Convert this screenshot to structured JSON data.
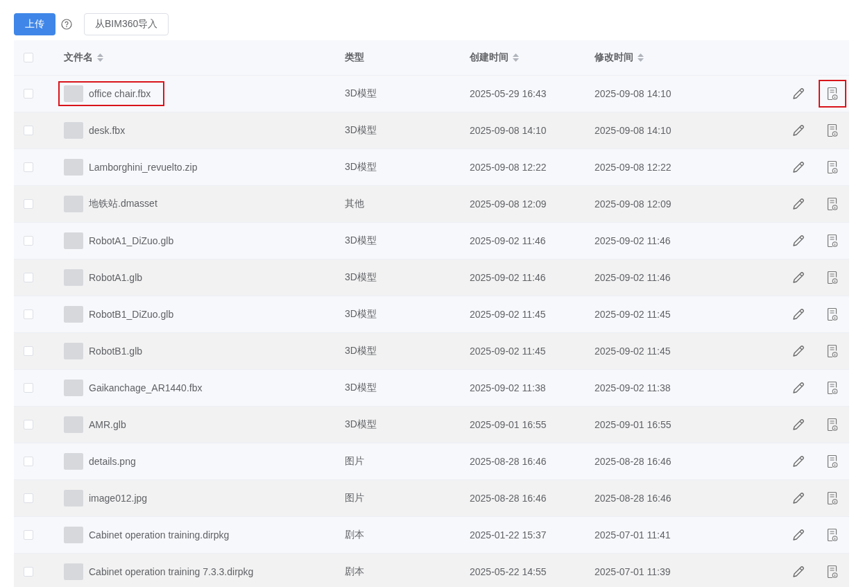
{
  "toolbar": {
    "upload_button": "上传",
    "import_button": "从BIM360导入"
  },
  "select_all_checked": false,
  "table": {
    "columns": [
      {
        "label": "文件名",
        "sortable": true
      },
      {
        "label": "类型",
        "sortable": false
      },
      {
        "label": "创建时间",
        "sortable": true
      },
      {
        "label": "修改时间",
        "sortable": true
      }
    ],
    "rows": [
      {
        "name": "office chair.fbx",
        "type": "3D模型",
        "created": "2025-05-29 16:43",
        "modified": "2025-09-08 14:10",
        "checked": false,
        "name_highlighted": true,
        "info_highlighted": true
      },
      {
        "name": "desk.fbx",
        "type": "3D模型",
        "created": "2025-09-08 14:10",
        "modified": "2025-09-08 14:10",
        "checked": false,
        "name_highlighted": false,
        "info_highlighted": false
      },
      {
        "name": "Lamborghini_revuelto.zip",
        "type": "3D模型",
        "created": "2025-09-08 12:22",
        "modified": "2025-09-08 12:22",
        "checked": false,
        "name_highlighted": false,
        "info_highlighted": false
      },
      {
        "name": "地铁站.dmasset",
        "type": "其他",
        "created": "2025-09-08 12:09",
        "modified": "2025-09-08 12:09",
        "checked": false,
        "name_highlighted": false,
        "info_highlighted": false
      },
      {
        "name": "RobotA1_DiZuo.glb",
        "type": "3D模型",
        "created": "2025-09-02 11:46",
        "modified": "2025-09-02 11:46",
        "checked": false,
        "name_highlighted": false,
        "info_highlighted": false
      },
      {
        "name": "RobotA1.glb",
        "type": "3D模型",
        "created": "2025-09-02 11:46",
        "modified": "2025-09-02 11:46",
        "checked": false,
        "name_highlighted": false,
        "info_highlighted": false
      },
      {
        "name": "RobotB1_DiZuo.glb",
        "type": "3D模型",
        "created": "2025-09-02 11:45",
        "modified": "2025-09-02 11:45",
        "checked": false,
        "name_highlighted": false,
        "info_highlighted": false
      },
      {
        "name": "RobotB1.glb",
        "type": "3D模型",
        "created": "2025-09-02 11:45",
        "modified": "2025-09-02 11:45",
        "checked": false,
        "name_highlighted": false,
        "info_highlighted": false
      },
      {
        "name": "Gaikanchage_AR1440.fbx",
        "type": "3D模型",
        "created": "2025-09-02 11:38",
        "modified": "2025-09-02 11:38",
        "checked": false,
        "name_highlighted": false,
        "info_highlighted": false
      },
      {
        "name": "AMR.glb",
        "type": "3D模型",
        "created": "2025-09-01 16:55",
        "modified": "2025-09-01 16:55",
        "checked": false,
        "name_highlighted": false,
        "info_highlighted": false
      },
      {
        "name": "details.png",
        "type": "图片",
        "created": "2025-08-28 16:46",
        "modified": "2025-08-28 16:46",
        "checked": false,
        "name_highlighted": false,
        "info_highlighted": false
      },
      {
        "name": "image012.jpg",
        "type": "图片",
        "created": "2025-08-28 16:46",
        "modified": "2025-08-28 16:46",
        "checked": false,
        "name_highlighted": false,
        "info_highlighted": false
      },
      {
        "name": "Cabinet operation training.dirpkg",
        "type": "剧本",
        "created": "2025-01-22 15:37",
        "modified": "2025-07-01 11:41",
        "checked": false,
        "name_highlighted": false,
        "info_highlighted": false
      },
      {
        "name": "Cabinet operation training 7.3.3.dirpkg",
        "type": "剧本",
        "created": "2025-05-22 14:55",
        "modified": "2025-07-01 11:39",
        "checked": false,
        "name_highlighted": false,
        "info_highlighted": false
      }
    ]
  }
}
